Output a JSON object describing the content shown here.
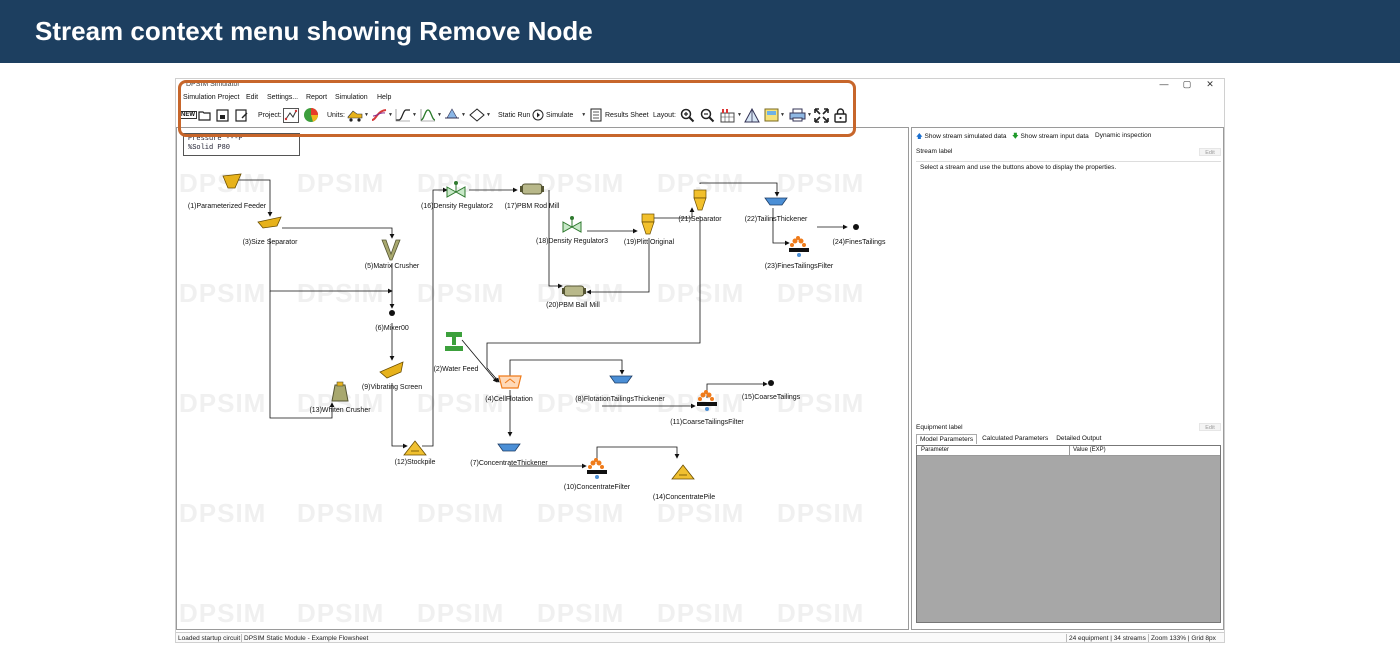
{
  "banner": {
    "title": "Stream context menu showing Remove Node"
  },
  "window": {
    "title": "DPSIM Simulator",
    "controls": {
      "minimize": "—",
      "maximize": "▢",
      "close": "✕"
    }
  },
  "menu": [
    "Simulation Project",
    "Edit",
    "Settings...",
    "Report",
    "Simulation",
    "Help"
  ],
  "toolbar": {
    "new_label": "NEW",
    "project_label": "Project:",
    "units_label": "Units:",
    "static_run": "Static Run",
    "simulate": "Simulate",
    "results_sheet": "Results Sheet",
    "layout_label": "Layout:"
  },
  "legend": {
    "line1": "Pressure  ---P",
    "line2": "%Solid   P80"
  },
  "watermark": {
    "text": "DPSIM"
  },
  "equipment": [
    {
      "id": "feeder",
      "label": "(1)Parameterized Feeder",
      "color": "#e7b21b"
    },
    {
      "id": "size-separator",
      "label": "(3)Size Separator",
      "color": "#e7b21b"
    },
    {
      "id": "matrix-crusher",
      "label": "(5)Matrix Crusher",
      "color": "#8d8d5a"
    },
    {
      "id": "mixer",
      "label": "(6)Mixer00",
      "color": "#111111"
    },
    {
      "id": "vibrating-screen",
      "label": "(9)Vibrating Screen",
      "color": "#e7b21b"
    },
    {
      "id": "whiten-crusher",
      "label": "(13)Whiten Crusher",
      "color": "#8d8d5a"
    },
    {
      "id": "stockpile",
      "label": "(12)Stockpile",
      "color": "#e7b21b"
    },
    {
      "id": "density-regulator2",
      "label": "(16)Density Regulator2",
      "color": "#4aa84a"
    },
    {
      "id": "pbm-rod-mill",
      "label": "(17)PBM Rod Mill",
      "color": "#8d8d5a"
    },
    {
      "id": "density-regulator3",
      "label": "(18)Density Regulator3",
      "color": "#4aa84a"
    },
    {
      "id": "plitt-original",
      "label": "(19)Plitt Original",
      "color": "#e7b21b"
    },
    {
      "id": "pbm-ball-mill",
      "label": "(20)PBM Ball Mill",
      "color": "#8d8d5a"
    },
    {
      "id": "separator",
      "label": "(21)Separator",
      "color": "#e7b21b"
    },
    {
      "id": "tailings-thickener",
      "label": "(22)TailinsThickener",
      "color": "#4b8fd6"
    },
    {
      "id": "fines-tailings-filter",
      "label": "(23)FinesTailingsFilter",
      "color": "#ef7b1a"
    },
    {
      "id": "fines-tailings",
      "label": "(24)FinesTailings",
      "color": "#111111"
    },
    {
      "id": "water-feed",
      "label": "(2)Water Feed",
      "color": "#3ca03c"
    },
    {
      "id": "cell-flotation",
      "label": "(4)CellFlotation",
      "color": "#ef7b1a"
    },
    {
      "id": "flotation-tailings-thickener",
      "label": "(8)FlotationTailingsThickener",
      "color": "#4b8fd6"
    },
    {
      "id": "coarse-tailings-filter",
      "label": "(11)CoarseTailingsFilter",
      "color": "#ef7b1a"
    },
    {
      "id": "coarse-tailings",
      "label": "(15)CoarseTailings",
      "color": "#111111"
    },
    {
      "id": "concentrate-thickener",
      "label": "(7)ConcentrateThickener",
      "color": "#4b8fd6"
    },
    {
      "id": "concentrate-filter",
      "label": "(10)ConcentrateFilter",
      "color": "#ef7b1a"
    },
    {
      "id": "concentrate-pile",
      "label": "(14)ConcentratePile",
      "color": "#e7b21b"
    }
  ],
  "right_panel": {
    "show_simulated": "Show stream simulated data",
    "show_input": "Show stream input data",
    "dynamic_inspection": "Dynamic inspection",
    "stream_label": "Stream label",
    "edit": "Edit",
    "stream_hint": "Select a stream and use the buttons above to display the properties.",
    "equipment_label": "Equipment label",
    "tabs": [
      "Model Parameters",
      "Calculated Parameters",
      "Detailed Output"
    ],
    "grid_columns": [
      "Parameter",
      "Value (EXP)"
    ]
  },
  "status": {
    "left": "Loaded startup circuit",
    "module": "DPSIM Static Module - Example Flowsheet",
    "counts": "24 equipment | 34 streams",
    "zoom": "Zoom 133% | Grid 8px"
  },
  "colors": {
    "banner": "#1d3f60",
    "highlight": "#c7662b",
    "grid": "#a7a7a7"
  }
}
